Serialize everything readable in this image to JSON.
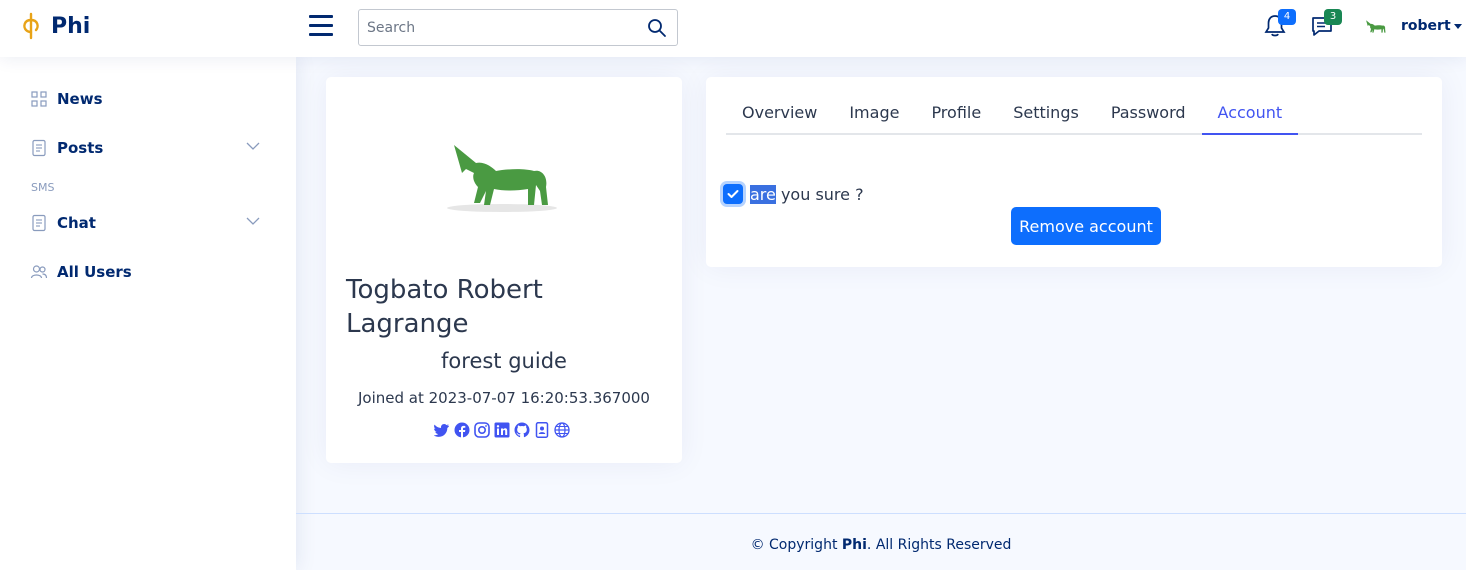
{
  "brand": {
    "name": "Phi"
  },
  "search": {
    "placeholder": "Search"
  },
  "notifications": {
    "count": "4"
  },
  "messages": {
    "count": "3"
  },
  "user": {
    "name": "robert"
  },
  "sidebar": {
    "items": [
      {
        "label": "News"
      },
      {
        "label": "Posts"
      },
      {
        "label": "Chat"
      },
      {
        "label": "All Users"
      }
    ],
    "heading_sms": "SMS"
  },
  "profile": {
    "name": "Togbato Robert Lagrange",
    "job": "forest guide",
    "joined": "Joined at 2023-07-07 16:20:53.367000",
    "socials": [
      "twitter-icon",
      "facebook-icon",
      "instagram-icon",
      "linkedin-icon",
      "github-icon",
      "contact-icon",
      "globe-icon"
    ]
  },
  "tabs": [
    "Overview",
    "Image",
    "Profile",
    "Settings",
    "Password",
    "Account"
  ],
  "active_tab": "Account",
  "account": {
    "confirm_selected": "are",
    "confirm_rest": " you sure ?",
    "checked": true,
    "remove_label": "Remove account"
  },
  "footer": {
    "prefix": "© Copyright ",
    "brand": "Phi",
    "suffix": ". All Rights Reserved"
  },
  "colors": {
    "brand": "#012970",
    "accent": "#4154f1",
    "primary_button": "#0d6efd",
    "notification_badge": "#0d6efd",
    "message_badge": "#198754",
    "unicorn": "#4a9a42"
  }
}
